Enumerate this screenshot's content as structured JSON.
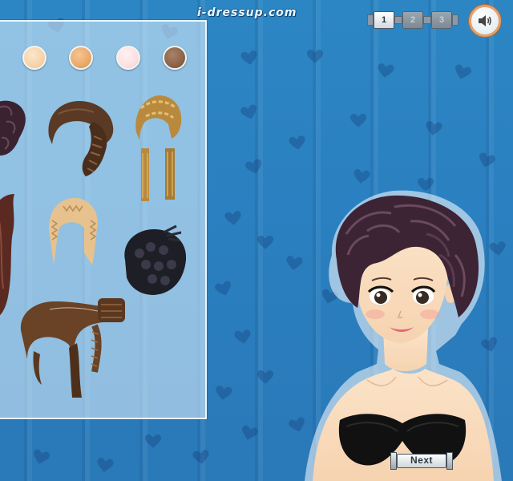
{
  "header": {
    "site_logo": "i-dressup.com"
  },
  "level_tabs": [
    {
      "label": "1",
      "active": true
    },
    {
      "label": "2",
      "active": false
    },
    {
      "label": "3",
      "active": false
    }
  ],
  "sound_button": {
    "icon": "speaker-icon"
  },
  "skin_swatches": [
    {
      "color": "#f6d3aa"
    },
    {
      "color": "#e9a96b"
    },
    {
      "color": "#fde0e0"
    },
    {
      "color": "#8a6448"
    }
  ],
  "hairstyles": [
    {
      "name": "hairstyle-dark-curly"
    },
    {
      "name": "hairstyle-brown-braided-bun"
    },
    {
      "name": "hairstyle-blonde-braids"
    },
    {
      "name": "hairstyle-auburn-long"
    },
    {
      "name": "hairstyle-blonde-crimped-bob"
    },
    {
      "name": "hairstyle-black-braided-updo"
    },
    {
      "name": "hairstyle-brown-braided-ponytail"
    }
  ],
  "next_button": {
    "label": "Next"
  },
  "colors": {
    "background": "#2b80c0",
    "panel_border": "#e9f6ff",
    "sound_ring": "#e7a06a"
  }
}
